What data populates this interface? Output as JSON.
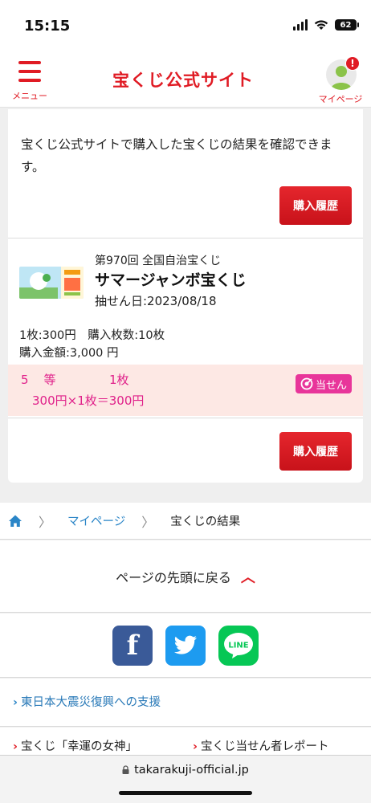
{
  "status_bar": {
    "time": "15:15",
    "battery": "62"
  },
  "header": {
    "menu_label": "メニュー",
    "logo": "宝くじ公式サイト",
    "mypage_label": "マイページ",
    "notification_badge": "!"
  },
  "card": {
    "intro": "宝くじ公式サイトで購入した宝くじの結果を確認できます。",
    "history_button": "購入履歴",
    "lottery": {
      "round": "第970回 全国自治宝くじ",
      "name": "サマージャンボ宝くじ",
      "draw_date": "抽せん日:2023/08/18",
      "purchase_line1": "1枚:300円　購入枚数:10枚",
      "purchase_line2": "購入金額:3,000 円"
    },
    "prize": {
      "rank": "5　等",
      "count": "1枚",
      "amount": "300円×1枚＝300円",
      "badge": "当せん"
    },
    "history_button_2": "購入履歴"
  },
  "breadcrumb": {
    "mypage": "マイページ",
    "current": "宝くじの結果"
  },
  "back_to_top": "ページの先頭に戻る",
  "social": {
    "line_label": "LINE"
  },
  "links": {
    "quake": "東日本大震災復興への支援",
    "goddess": "宝くじ「幸運の女神」",
    "winner_report": "宝くじ当せん者レポート"
  },
  "url_bar": {
    "url": "takarakuji-official.jp"
  },
  "colors": {
    "brand_red": "#e01b24",
    "prize_pink": "#e0218a",
    "link_blue": "#2a85c7"
  }
}
